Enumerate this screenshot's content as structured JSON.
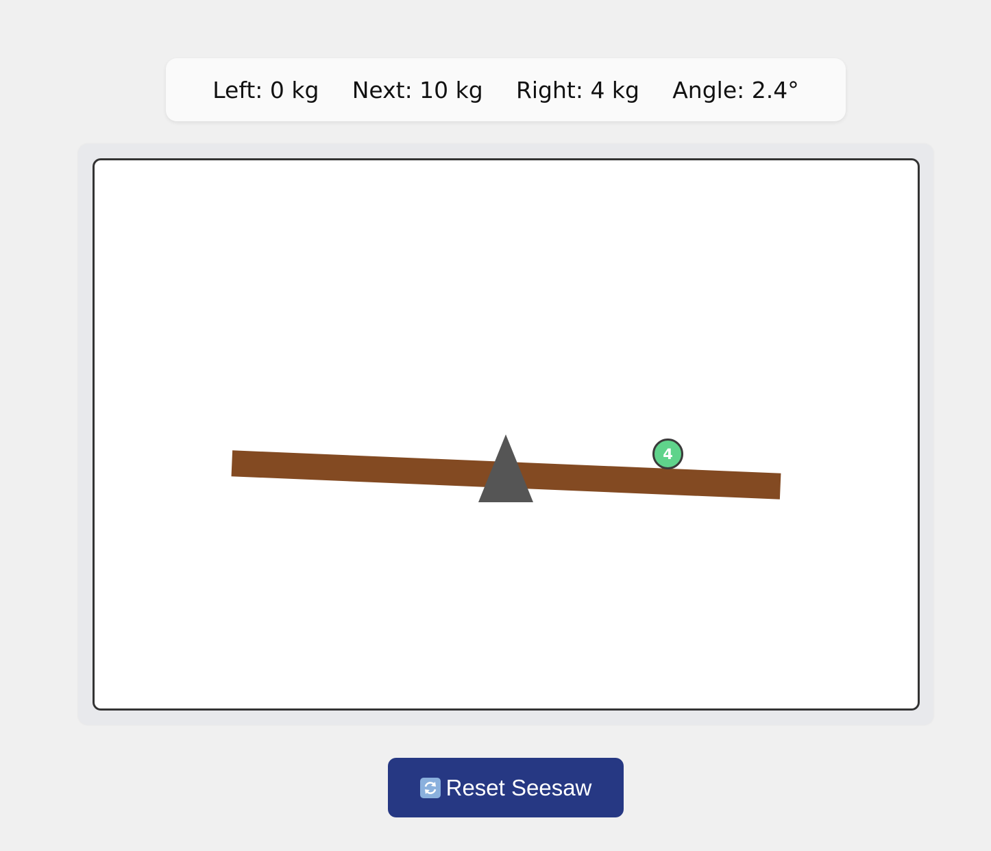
{
  "stats": {
    "left": "Left: 0 kg",
    "next": "Next: 10 kg",
    "right": "Right: 4 kg",
    "angle": "Angle: 2.4°"
  },
  "seesaw": {
    "angle_deg": 2.4,
    "left_total_kg": 0,
    "right_total_kg": 4,
    "next_weight_kg": 10,
    "plank_color": "#834a22",
    "fulcrum_color": "#555555",
    "weights": [
      {
        "label": "4",
        "kg": 4,
        "side": "right",
        "color": "#5fd38b"
      }
    ]
  },
  "controls": {
    "reset_label": "Reset Seesaw",
    "reset_icon": "refresh-icon",
    "reset_color": "#263883"
  }
}
